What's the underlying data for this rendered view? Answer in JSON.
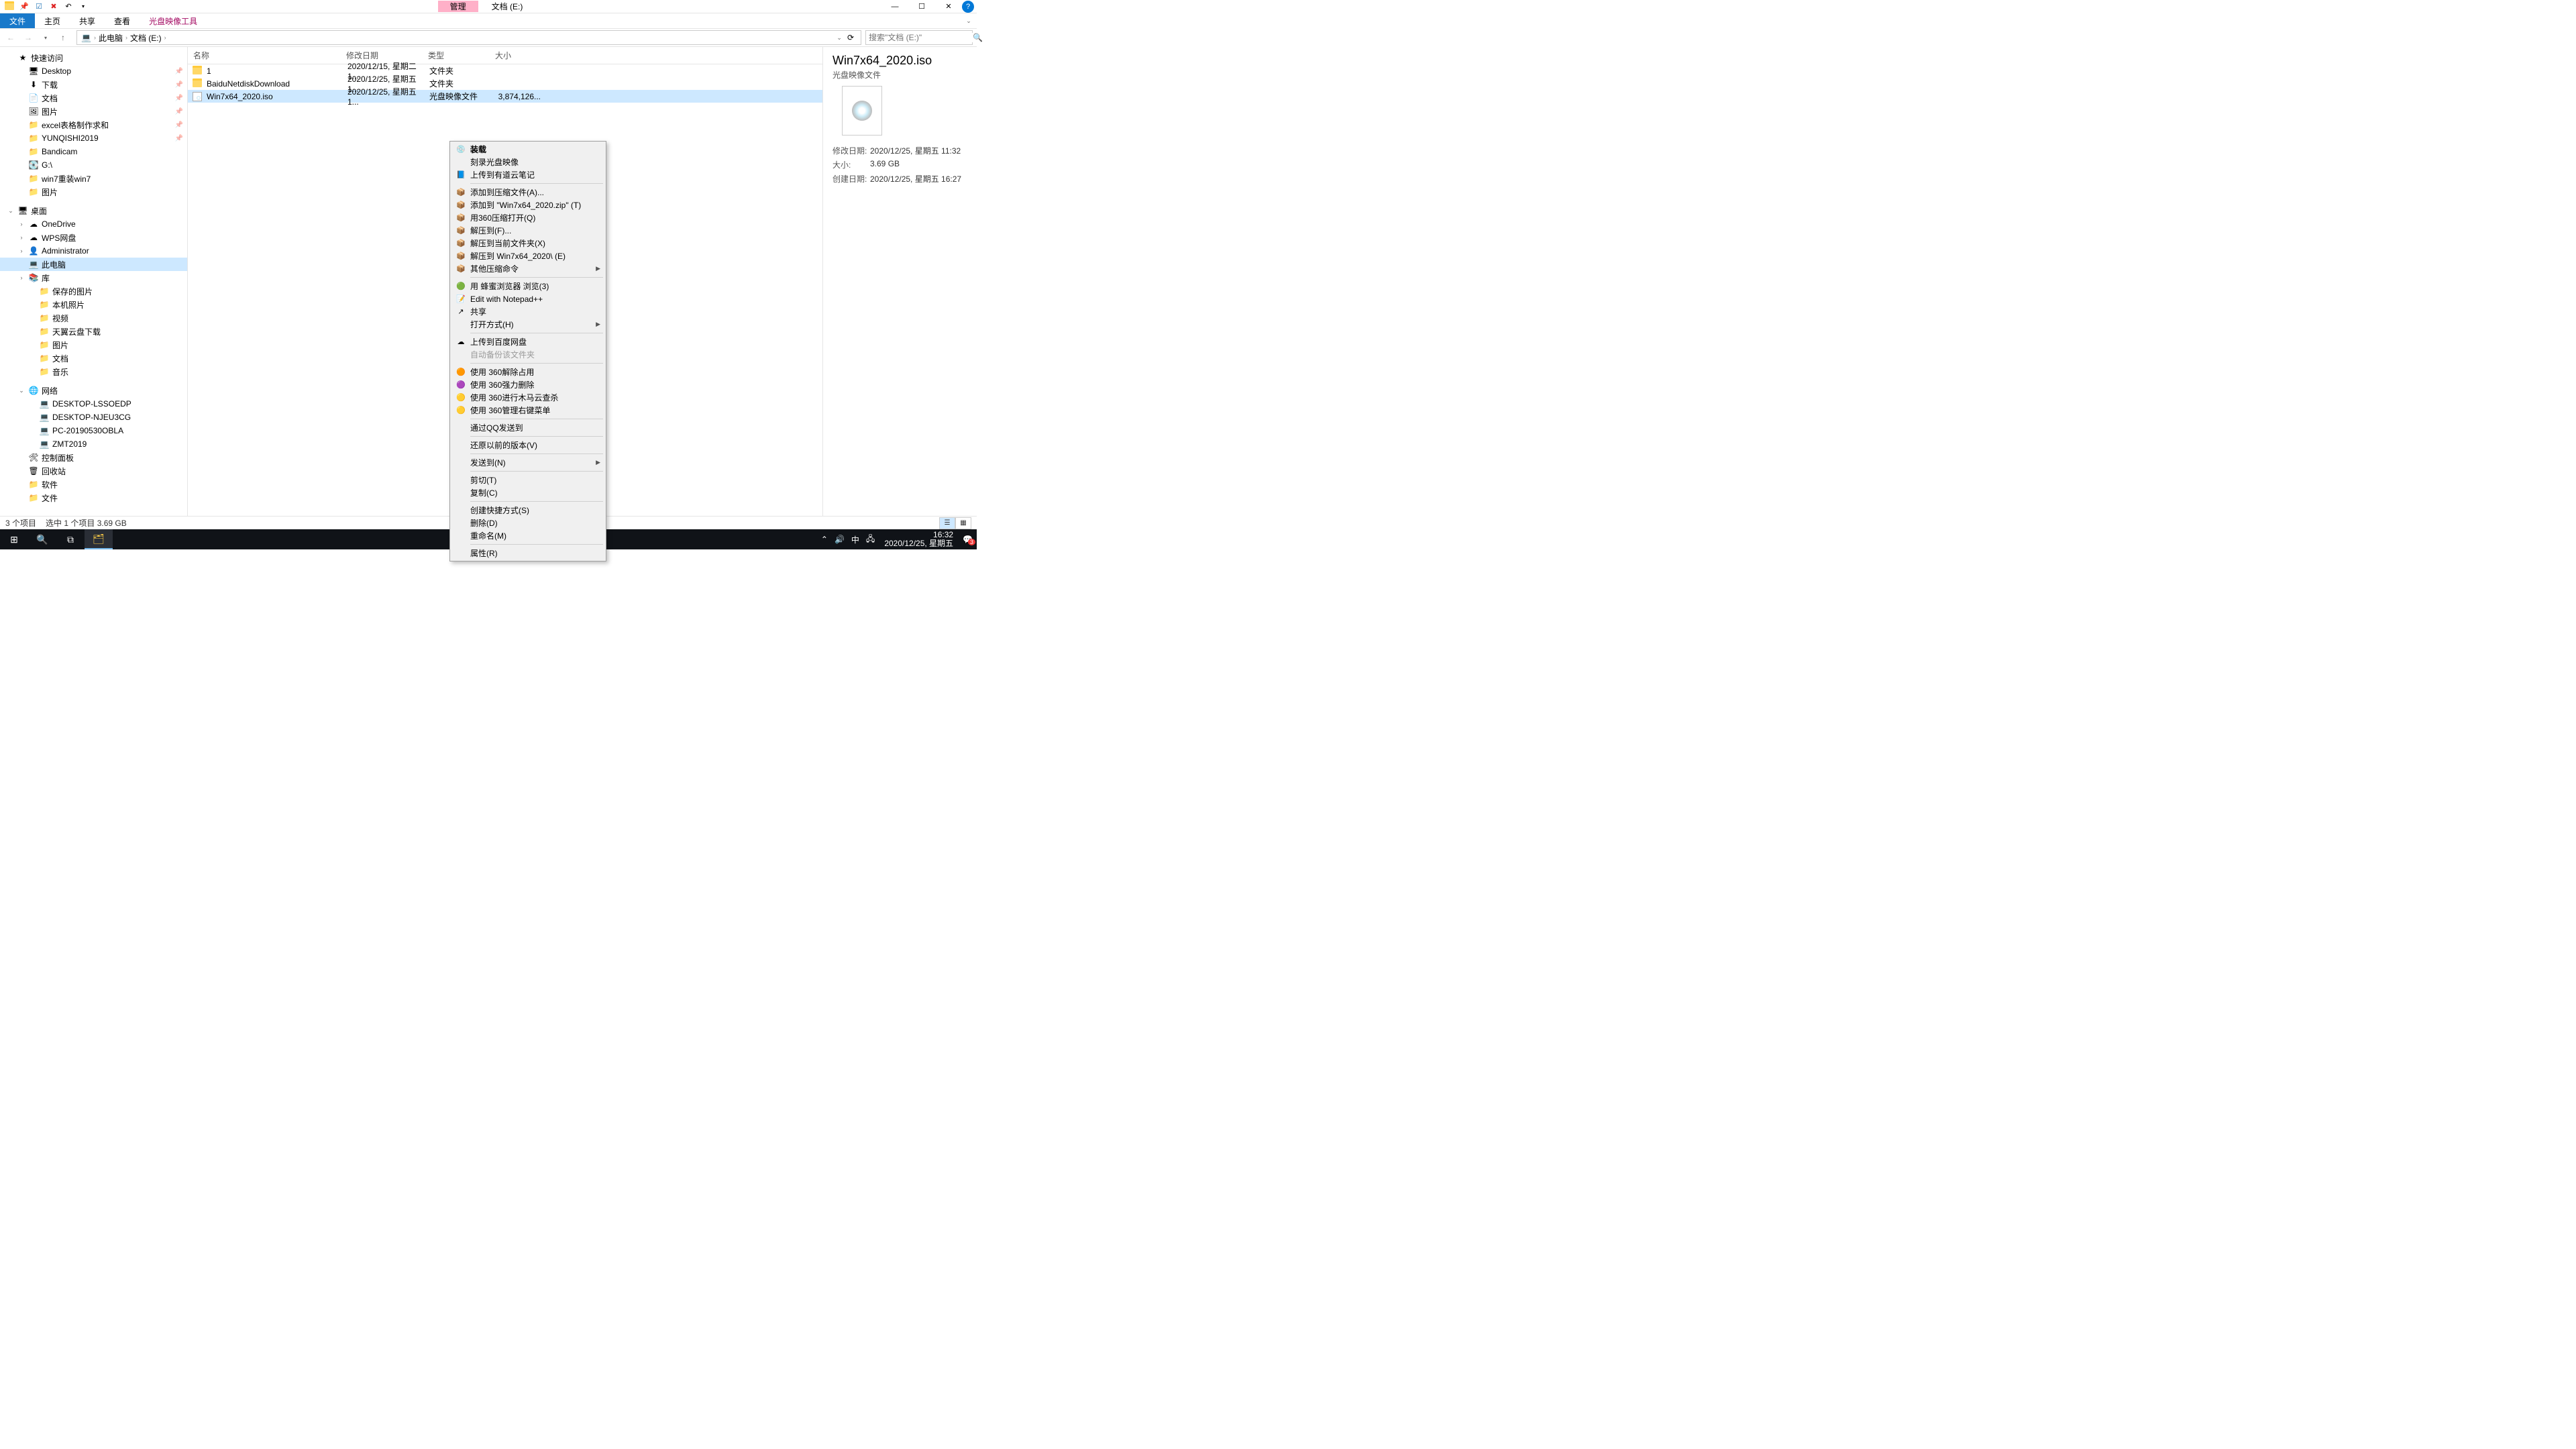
{
  "window": {
    "ctx_tab": "管理",
    "title": "文档 (E:)",
    "ribbon_tabs": [
      "文件",
      "主页",
      "共享",
      "查看"
    ],
    "ribbon_ctx": "光盘映像工具"
  },
  "address": {
    "crumbs": [
      "此电脑",
      "文档 (E:)"
    ],
    "search_placeholder": "搜索\"文档 (E:)\""
  },
  "sidebar": {
    "quick": {
      "label": "快速访问",
      "items": [
        {
          "label": "Desktop",
          "pin": true,
          "ic": "🖥"
        },
        {
          "label": "下载",
          "pin": true,
          "ic": "⬇"
        },
        {
          "label": "文档",
          "pin": true,
          "ic": "📄"
        },
        {
          "label": "图片",
          "pin": true,
          "ic": "🖼"
        },
        {
          "label": "excel表格制作求和",
          "pin": true,
          "ic": "📁"
        },
        {
          "label": "YUNQISHI2019",
          "pin": true,
          "ic": "📁"
        },
        {
          "label": "Bandicam",
          "ic": "📁"
        },
        {
          "label": "G:\\",
          "ic": "💽"
        },
        {
          "label": "win7重装win7",
          "ic": "📁"
        },
        {
          "label": "图片",
          "ic": "📁"
        }
      ]
    },
    "desktop": {
      "label": "桌面",
      "items": [
        {
          "label": "OneDrive",
          "ic": "☁"
        },
        {
          "label": "WPS网盘",
          "ic": "☁"
        },
        {
          "label": "Administrator",
          "ic": "👤"
        },
        {
          "label": "此电脑",
          "ic": "💻",
          "sel": true
        },
        {
          "label": "库",
          "ic": "📚"
        }
      ]
    },
    "library_items": [
      {
        "label": "保存的图片"
      },
      {
        "label": "本机照片"
      },
      {
        "label": "视频"
      },
      {
        "label": "天翼云盘下载"
      },
      {
        "label": "图片"
      },
      {
        "label": "文档"
      },
      {
        "label": "音乐"
      }
    ],
    "network": {
      "label": "网络",
      "items": [
        {
          "label": "DESKTOP-LSSOEDP"
        },
        {
          "label": "DESKTOP-NJEU3CG"
        },
        {
          "label": "PC-20190530OBLA"
        },
        {
          "label": "ZMT2019"
        }
      ]
    },
    "extras": [
      {
        "label": "控制面板",
        "ic": "🛠"
      },
      {
        "label": "回收站",
        "ic": "🗑"
      },
      {
        "label": "软件",
        "ic": "📁"
      },
      {
        "label": "文件",
        "ic": "📁"
      }
    ]
  },
  "columns": {
    "name": "名称",
    "date": "修改日期",
    "type": "类型",
    "size": "大小"
  },
  "files": [
    {
      "name": "1",
      "date": "2020/12/15, 星期二 1...",
      "type": "文件夹",
      "size": "",
      "ic": "folder"
    },
    {
      "name": "BaiduNetdiskDownload",
      "date": "2020/12/25, 星期五 1...",
      "type": "文件夹",
      "size": "",
      "ic": "folder"
    },
    {
      "name": "Win7x64_2020.iso",
      "date": "2020/12/25, 星期五 1...",
      "type": "光盘映像文件",
      "size": "3,874,126...",
      "ic": "iso",
      "sel": true
    }
  ],
  "context_menu": [
    {
      "label": "装载",
      "bold": true,
      "ic": "💿"
    },
    {
      "label": "刻录光盘映像"
    },
    {
      "label": "上传到有道云笔记",
      "ic": "📘"
    },
    {
      "sep": true
    },
    {
      "label": "添加到压缩文件(A)...",
      "ic": "📦"
    },
    {
      "label": "添加到 \"Win7x64_2020.zip\" (T)",
      "ic": "📦"
    },
    {
      "label": "用360压缩打开(Q)",
      "ic": "📦"
    },
    {
      "label": "解压到(F)...",
      "ic": "📦"
    },
    {
      "label": "解压到当前文件夹(X)",
      "ic": "📦"
    },
    {
      "label": "解压到 Win7x64_2020\\ (E)",
      "ic": "📦"
    },
    {
      "label": "其他压缩命令",
      "ic": "📦",
      "sub": true
    },
    {
      "sep": true
    },
    {
      "label": "用 蜂蜜浏览器 浏览(3)",
      "ic": "🟢"
    },
    {
      "label": "Edit with Notepad++",
      "ic": "📝"
    },
    {
      "label": "共享",
      "ic": "↗"
    },
    {
      "label": "打开方式(H)",
      "sub": true
    },
    {
      "sep": true
    },
    {
      "label": "上传到百度网盘",
      "ic": "☁"
    },
    {
      "label": "自动备份该文件夹",
      "disabled": true
    },
    {
      "sep": true
    },
    {
      "label": "使用 360解除占用",
      "ic": "🟠"
    },
    {
      "label": "使用 360强力删除",
      "ic": "🟣"
    },
    {
      "label": "使用 360进行木马云查杀",
      "ic": "🟡"
    },
    {
      "label": "使用 360管理右键菜单",
      "ic": "🟡"
    },
    {
      "sep": true
    },
    {
      "label": "通过QQ发送到"
    },
    {
      "sep": true
    },
    {
      "label": "还原以前的版本(V)"
    },
    {
      "sep": true
    },
    {
      "label": "发送到(N)",
      "sub": true
    },
    {
      "sep": true
    },
    {
      "label": "剪切(T)"
    },
    {
      "label": "复制(C)"
    },
    {
      "sep": true
    },
    {
      "label": "创建快捷方式(S)"
    },
    {
      "label": "删除(D)"
    },
    {
      "label": "重命名(M)"
    },
    {
      "sep": true
    },
    {
      "label": "属性(R)"
    }
  ],
  "details": {
    "filename": "Win7x64_2020.iso",
    "filetype": "光盘映像文件",
    "rows": [
      {
        "k": "修改日期:",
        "v": "2020/12/25, 星期五 11:32"
      },
      {
        "k": "大小:",
        "v": "3.69 GB"
      },
      {
        "k": "创建日期:",
        "v": "2020/12/25, 星期五 16:27"
      }
    ]
  },
  "status": {
    "items": "3 个项目",
    "sel": "选中 1 个项目  3.69 GB"
  },
  "taskbar": {
    "ime": "中",
    "time": "16:32",
    "date": "2020/12/25, 星期五",
    "badge": "3"
  }
}
